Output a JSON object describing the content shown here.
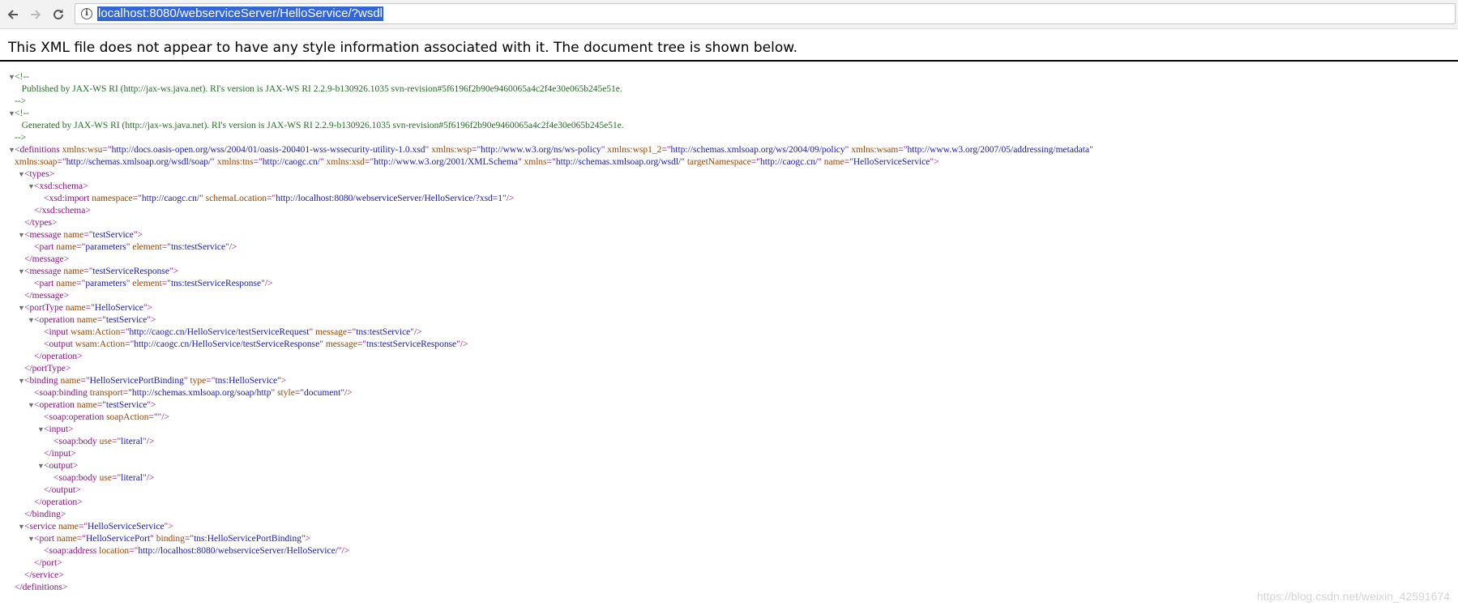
{
  "browser": {
    "url": "localhost:8080/webserviceServer/HelloService/?wsdl"
  },
  "banner": "This XML file does not appear to have any style information associated with it. The document tree is shown below.",
  "xml_lines": [
    {
      "indent": 0,
      "toggle": true,
      "tokens": [
        [
          "cm",
          "<!--"
        ]
      ]
    },
    {
      "indent": 0,
      "tokens": [
        [
          "cm",
          "   Published by JAX-WS RI (http://jax-ws.java.net). RI's version is JAX-WS RI 2.2.9-b130926.1035 svn-revision#5f6196f2b90e9460065a4c2f4e30e065b245e51e."
        ]
      ]
    },
    {
      "indent": 0,
      "tokens": [
        [
          "cm",
          "-->"
        ]
      ]
    },
    {
      "indent": 0,
      "toggle": true,
      "tokens": [
        [
          "cm",
          "<!--"
        ]
      ]
    },
    {
      "indent": 0,
      "tokens": [
        [
          "cm",
          "   Generated by JAX-WS RI (http://jax-ws.java.net). RI's version is JAX-WS RI 2.2.9-b130926.1035 svn-revision#5f6196f2b90e9460065a4c2f4e30e065b245e51e."
        ]
      ]
    },
    {
      "indent": 0,
      "tokens": [
        [
          "cm",
          "-->"
        ]
      ]
    },
    {
      "indent": 0,
      "toggle": true,
      "tokens": [
        [
          "tg",
          "<definitions "
        ],
        [
          "an",
          "xmlns:wsu"
        ],
        [
          "tg",
          "=\""
        ],
        [
          "av",
          "http://docs.oasis-open.org/wss/2004/01/oasis-200401-wss-wssecurity-utility-1.0.xsd"
        ],
        [
          "tg",
          "\" "
        ],
        [
          "an",
          "xmlns:wsp"
        ],
        [
          "tg",
          "=\""
        ],
        [
          "av",
          "http://www.w3.org/ns/ws-policy"
        ],
        [
          "tg",
          "\" "
        ],
        [
          "an",
          "xmlns:wsp1_2"
        ],
        [
          "tg",
          "=\""
        ],
        [
          "av",
          "http://schemas.xmlsoap.org/ws/2004/09/policy"
        ],
        [
          "tg",
          "\" "
        ],
        [
          "an",
          "xmlns:wsam"
        ],
        [
          "tg",
          "=\""
        ],
        [
          "av",
          "http://www.w3.org/2007/05/addressing/metadata"
        ],
        [
          "tg",
          "\""
        ]
      ]
    },
    {
      "indent": 0,
      "tokens": [
        [
          "an",
          "xmlns:soap"
        ],
        [
          "tg",
          "=\""
        ],
        [
          "av",
          "http://schemas.xmlsoap.org/wsdl/soap/"
        ],
        [
          "tg",
          "\" "
        ],
        [
          "an",
          "xmlns:tns"
        ],
        [
          "tg",
          "=\""
        ],
        [
          "av",
          "http://caogc.cn/"
        ],
        [
          "tg",
          "\" "
        ],
        [
          "an",
          "xmlns:xsd"
        ],
        [
          "tg",
          "=\""
        ],
        [
          "av",
          "http://www.w3.org/2001/XMLSchema"
        ],
        [
          "tg",
          "\" "
        ],
        [
          "an",
          "xmlns"
        ],
        [
          "tg",
          "=\""
        ],
        [
          "av",
          "http://schemas.xmlsoap.org/wsdl/"
        ],
        [
          "tg",
          "\" "
        ],
        [
          "an",
          "targetNamespace"
        ],
        [
          "tg",
          "=\""
        ],
        [
          "av",
          "http://caogc.cn/"
        ],
        [
          "tg",
          "\" "
        ],
        [
          "an",
          "name"
        ],
        [
          "tg",
          "=\""
        ],
        [
          "av",
          "HelloServiceService"
        ],
        [
          "tg",
          "\">"
        ]
      ]
    },
    {
      "indent": 1,
      "toggle": true,
      "tokens": [
        [
          "tg",
          "<types>"
        ]
      ]
    },
    {
      "indent": 2,
      "toggle": true,
      "tokens": [
        [
          "tg",
          "<xsd:schema>"
        ]
      ]
    },
    {
      "indent": 3,
      "tokens": [
        [
          "tg",
          "<xsd:import "
        ],
        [
          "an",
          "namespace"
        ],
        [
          "tg",
          "=\""
        ],
        [
          "av",
          "http://caogc.cn/"
        ],
        [
          "tg",
          "\" "
        ],
        [
          "an",
          "schemaLocation"
        ],
        [
          "tg",
          "=\""
        ],
        [
          "av",
          "http://localhost:8080/webserviceServer/HelloService/?xsd=1"
        ],
        [
          "tg",
          "\"/>"
        ]
      ]
    },
    {
      "indent": 2,
      "tokens": [
        [
          "tg",
          "</xsd:schema>"
        ]
      ]
    },
    {
      "indent": 1,
      "tokens": [
        [
          "tg",
          "</types>"
        ]
      ]
    },
    {
      "indent": 1,
      "toggle": true,
      "tokens": [
        [
          "tg",
          "<message "
        ],
        [
          "an",
          "name"
        ],
        [
          "tg",
          "=\""
        ],
        [
          "av",
          "testService"
        ],
        [
          "tg",
          "\">"
        ]
      ]
    },
    {
      "indent": 2,
      "tokens": [
        [
          "tg",
          "<part "
        ],
        [
          "an",
          "name"
        ],
        [
          "tg",
          "=\""
        ],
        [
          "av",
          "parameters"
        ],
        [
          "tg",
          "\" "
        ],
        [
          "an",
          "element"
        ],
        [
          "tg",
          "=\""
        ],
        [
          "av",
          "tns:testService"
        ],
        [
          "tg",
          "\"/>"
        ]
      ]
    },
    {
      "indent": 1,
      "tokens": [
        [
          "tg",
          "</message>"
        ]
      ]
    },
    {
      "indent": 1,
      "toggle": true,
      "tokens": [
        [
          "tg",
          "<message "
        ],
        [
          "an",
          "name"
        ],
        [
          "tg",
          "=\""
        ],
        [
          "av",
          "testServiceResponse"
        ],
        [
          "tg",
          "\">"
        ]
      ]
    },
    {
      "indent": 2,
      "tokens": [
        [
          "tg",
          "<part "
        ],
        [
          "an",
          "name"
        ],
        [
          "tg",
          "=\""
        ],
        [
          "av",
          "parameters"
        ],
        [
          "tg",
          "\" "
        ],
        [
          "an",
          "element"
        ],
        [
          "tg",
          "=\""
        ],
        [
          "av",
          "tns:testServiceResponse"
        ],
        [
          "tg",
          "\"/>"
        ]
      ]
    },
    {
      "indent": 1,
      "tokens": [
        [
          "tg",
          "</message>"
        ]
      ]
    },
    {
      "indent": 1,
      "toggle": true,
      "tokens": [
        [
          "tg",
          "<portType "
        ],
        [
          "an",
          "name"
        ],
        [
          "tg",
          "=\""
        ],
        [
          "av",
          "HelloService"
        ],
        [
          "tg",
          "\">"
        ]
      ]
    },
    {
      "indent": 2,
      "toggle": true,
      "tokens": [
        [
          "tg",
          "<operation "
        ],
        [
          "an",
          "name"
        ],
        [
          "tg",
          "=\""
        ],
        [
          "av",
          "testService"
        ],
        [
          "tg",
          "\">"
        ]
      ]
    },
    {
      "indent": 3,
      "tokens": [
        [
          "tg",
          "<input "
        ],
        [
          "an",
          "wsam:Action"
        ],
        [
          "tg",
          "=\""
        ],
        [
          "av",
          "http://caogc.cn/HelloService/testServiceRequest"
        ],
        [
          "tg",
          "\" "
        ],
        [
          "an",
          "message"
        ],
        [
          "tg",
          "=\""
        ],
        [
          "av",
          "tns:testService"
        ],
        [
          "tg",
          "\"/>"
        ]
      ]
    },
    {
      "indent": 3,
      "tokens": [
        [
          "tg",
          "<output "
        ],
        [
          "an",
          "wsam:Action"
        ],
        [
          "tg",
          "=\""
        ],
        [
          "av",
          "http://caogc.cn/HelloService/testServiceResponse"
        ],
        [
          "tg",
          "\" "
        ],
        [
          "an",
          "message"
        ],
        [
          "tg",
          "=\""
        ],
        [
          "av",
          "tns:testServiceResponse"
        ],
        [
          "tg",
          "\"/>"
        ]
      ]
    },
    {
      "indent": 2,
      "tokens": [
        [
          "tg",
          "</operation>"
        ]
      ]
    },
    {
      "indent": 1,
      "tokens": [
        [
          "tg",
          "</portType>"
        ]
      ]
    },
    {
      "indent": 1,
      "toggle": true,
      "tokens": [
        [
          "tg",
          "<binding "
        ],
        [
          "an",
          "name"
        ],
        [
          "tg",
          "=\""
        ],
        [
          "av",
          "HelloServicePortBinding"
        ],
        [
          "tg",
          "\" "
        ],
        [
          "an",
          "type"
        ],
        [
          "tg",
          "=\""
        ],
        [
          "av",
          "tns:HelloService"
        ],
        [
          "tg",
          "\">"
        ]
      ]
    },
    {
      "indent": 2,
      "tokens": [
        [
          "tg",
          "<soap:binding "
        ],
        [
          "an",
          "transport"
        ],
        [
          "tg",
          "=\""
        ],
        [
          "av",
          "http://schemas.xmlsoap.org/soap/http"
        ],
        [
          "tg",
          "\" "
        ],
        [
          "an",
          "style"
        ],
        [
          "tg",
          "=\""
        ],
        [
          "av",
          "document"
        ],
        [
          "tg",
          "\"/>"
        ]
      ]
    },
    {
      "indent": 2,
      "toggle": true,
      "tokens": [
        [
          "tg",
          "<operation "
        ],
        [
          "an",
          "name"
        ],
        [
          "tg",
          "=\""
        ],
        [
          "av",
          "testService"
        ],
        [
          "tg",
          "\">"
        ]
      ]
    },
    {
      "indent": 3,
      "tokens": [
        [
          "tg",
          "<soap:operation "
        ],
        [
          "an",
          "soapAction"
        ],
        [
          "tg",
          "=\"\"/>"
        ]
      ]
    },
    {
      "indent": 3,
      "toggle": true,
      "tokens": [
        [
          "tg",
          "<input>"
        ]
      ]
    },
    {
      "indent": 4,
      "tokens": [
        [
          "tg",
          "<soap:body "
        ],
        [
          "an",
          "use"
        ],
        [
          "tg",
          "=\""
        ],
        [
          "av",
          "literal"
        ],
        [
          "tg",
          "\"/>"
        ]
      ]
    },
    {
      "indent": 3,
      "tokens": [
        [
          "tg",
          "</input>"
        ]
      ]
    },
    {
      "indent": 3,
      "toggle": true,
      "tokens": [
        [
          "tg",
          "<output>"
        ]
      ]
    },
    {
      "indent": 4,
      "tokens": [
        [
          "tg",
          "<soap:body "
        ],
        [
          "an",
          "use"
        ],
        [
          "tg",
          "=\""
        ],
        [
          "av",
          "literal"
        ],
        [
          "tg",
          "\"/>"
        ]
      ]
    },
    {
      "indent": 3,
      "tokens": [
        [
          "tg",
          "</output>"
        ]
      ]
    },
    {
      "indent": 2,
      "tokens": [
        [
          "tg",
          "</operation>"
        ]
      ]
    },
    {
      "indent": 1,
      "tokens": [
        [
          "tg",
          "</binding>"
        ]
      ]
    },
    {
      "indent": 1,
      "toggle": true,
      "tokens": [
        [
          "tg",
          "<service "
        ],
        [
          "an",
          "name"
        ],
        [
          "tg",
          "=\""
        ],
        [
          "av",
          "HelloServiceService"
        ],
        [
          "tg",
          "\">"
        ]
      ]
    },
    {
      "indent": 2,
      "toggle": true,
      "tokens": [
        [
          "tg",
          "<port "
        ],
        [
          "an",
          "name"
        ],
        [
          "tg",
          "=\""
        ],
        [
          "av",
          "HelloServicePort"
        ],
        [
          "tg",
          "\" "
        ],
        [
          "an",
          "binding"
        ],
        [
          "tg",
          "=\""
        ],
        [
          "av",
          "tns:HelloServicePortBinding"
        ],
        [
          "tg",
          "\">"
        ]
      ]
    },
    {
      "indent": 3,
      "tokens": [
        [
          "tg",
          "<soap:address "
        ],
        [
          "an",
          "location"
        ],
        [
          "tg",
          "=\""
        ],
        [
          "av",
          "http://localhost:8080/webserviceServer/HelloService/"
        ],
        [
          "tg",
          "\"/>"
        ]
      ]
    },
    {
      "indent": 2,
      "tokens": [
        [
          "tg",
          "</port>"
        ]
      ]
    },
    {
      "indent": 1,
      "tokens": [
        [
          "tg",
          "</service>"
        ]
      ]
    },
    {
      "indent": 0,
      "tokens": [
        [
          "tg",
          "</definitions>"
        ]
      ]
    }
  ],
  "watermark": "https://blog.csdn.net/weixin_42591674"
}
